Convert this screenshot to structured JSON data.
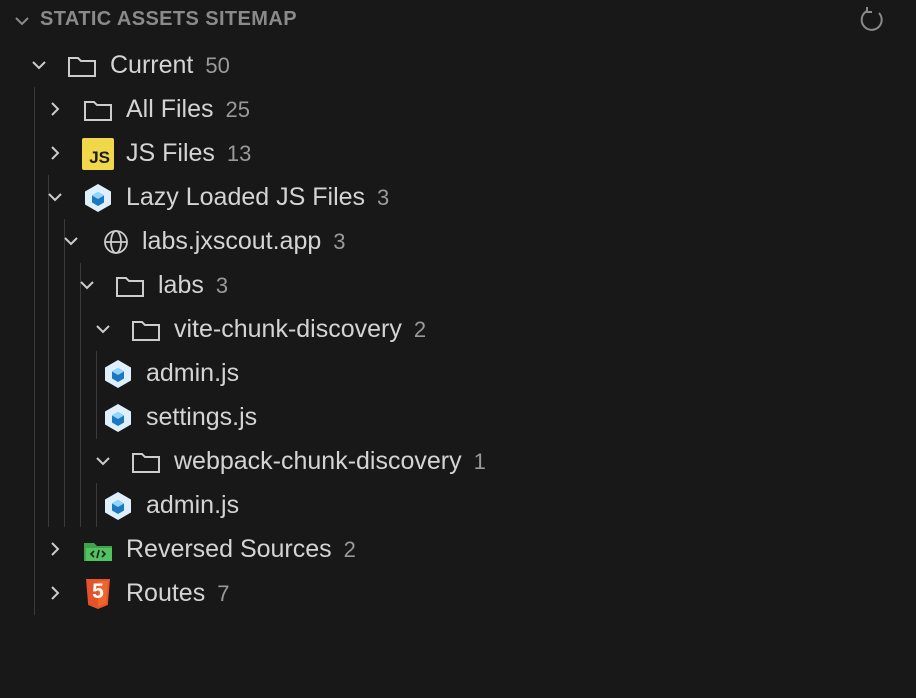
{
  "panel": {
    "title": "STATIC ASSETS SITEMAP",
    "collapse_icon": "chevron-down-icon",
    "refresh_icon": "refresh-icon"
  },
  "tree": {
    "current": {
      "label": "Current",
      "count": "50",
      "icon": "folder-icon",
      "expanded": true
    },
    "all_files": {
      "label": "All Files",
      "count": "25",
      "icon": "folder-icon",
      "expanded": false
    },
    "js_files": {
      "label": "JS Files",
      "count": "13",
      "icon": "js-icon",
      "icon_text": "JS",
      "expanded": false
    },
    "lazy_loaded": {
      "label": "Lazy Loaded JS Files",
      "count": "3",
      "icon": "webpack-icon",
      "expanded": true
    },
    "domain": {
      "label": "labs.jxscout.app",
      "count": "3",
      "icon": "globe-icon",
      "expanded": true
    },
    "labs": {
      "label": "labs",
      "count": "3",
      "icon": "folder-icon",
      "expanded": true
    },
    "vite": {
      "label": "vite-chunk-discovery",
      "count": "2",
      "icon": "folder-icon",
      "expanded": true
    },
    "vite_admin": {
      "label": "admin.js",
      "icon": "webpack-icon"
    },
    "vite_settings": {
      "label": "settings.js",
      "icon": "webpack-icon"
    },
    "webpack": {
      "label": "webpack-chunk-discovery",
      "count": "1",
      "icon": "folder-icon",
      "expanded": true
    },
    "webpack_admin": {
      "label": "admin.js",
      "icon": "webpack-icon"
    },
    "reversed": {
      "label": "Reversed Sources",
      "count": "2",
      "icon": "source-folder-icon",
      "expanded": false
    },
    "routes": {
      "label": "Routes",
      "count": "7",
      "icon": "html5-icon",
      "icon_text": "5",
      "expanded": false
    }
  },
  "colors": {
    "background": "#181818",
    "text": "#d4d4d4",
    "count": "#9a9a9a",
    "js_badge": "#f0d84a",
    "webpack_blue": "#8ec5f0",
    "html5_orange": "#e5532d",
    "source_green": "#3fa34d"
  }
}
